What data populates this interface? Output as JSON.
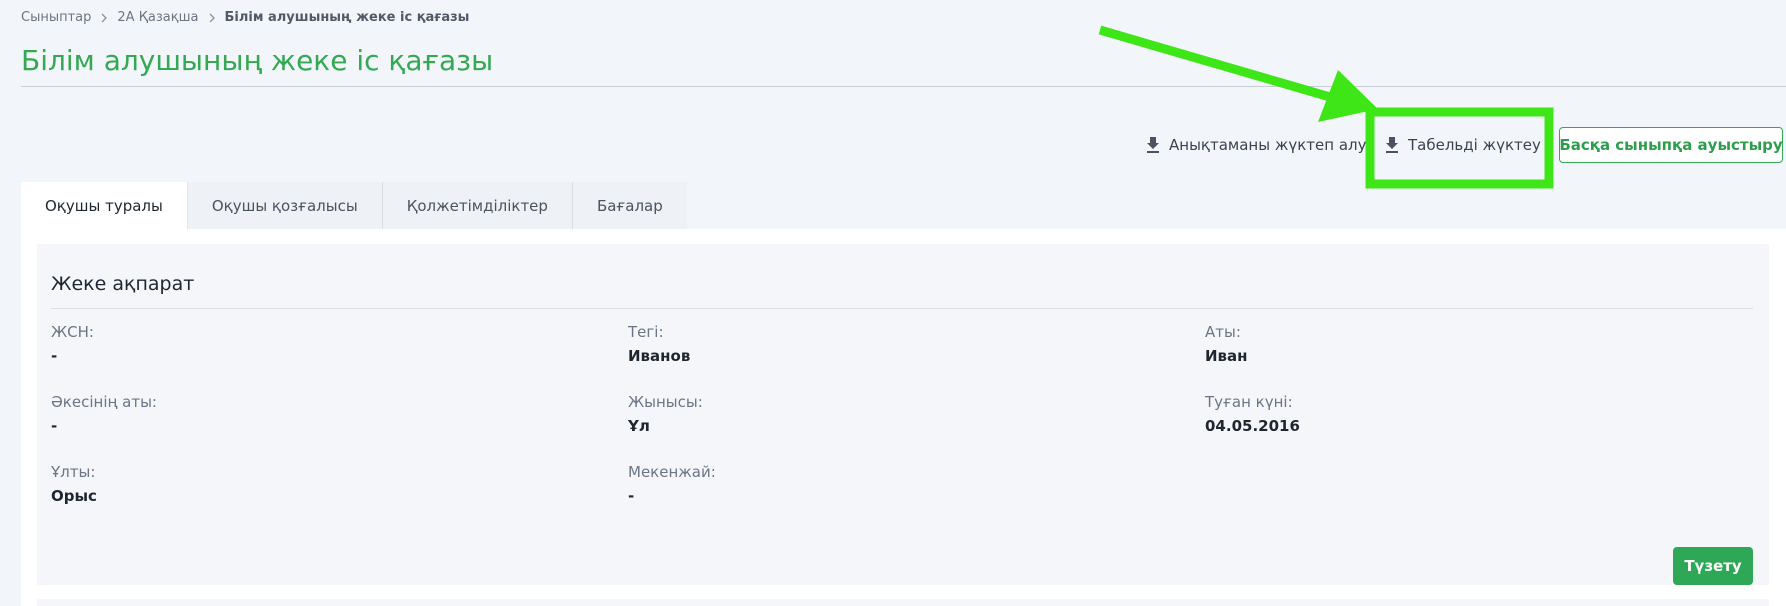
{
  "breadcrumb": {
    "items": [
      "Сыныптар",
      "2А Қазақша",
      "Білім алушының жеке іс қағазы"
    ]
  },
  "page": {
    "title": "Білім алушының жеке іс қағазы"
  },
  "actions": {
    "download_certificate": "Анықтаманы жүктеп алу",
    "download_tabel": "Табельді жүктеу",
    "transfer_class": "Басқа сыныпқа ауыстыру"
  },
  "tabs": [
    {
      "label": "Оқушы туралы",
      "active": true
    },
    {
      "label": "Оқушы қозғалысы",
      "active": false
    },
    {
      "label": "Қолжетімділіктер",
      "active": false
    },
    {
      "label": "Бағалар",
      "active": false
    }
  ],
  "personal": {
    "title": "Жеке ақпарат",
    "fields": [
      {
        "label": "ЖСН:",
        "value": "-"
      },
      {
        "label": "Тегі:",
        "value": "Иванов"
      },
      {
        "label": "Аты:",
        "value": "Иван"
      },
      {
        "label": "Әкесінің аты:",
        "value": "-"
      },
      {
        "label": "Жынысы:",
        "value": "Ұл"
      },
      {
        "label": "Туған күні:",
        "value": "04.05.2016"
      },
      {
        "label": "Ұлты:",
        "value": "Орыс"
      },
      {
        "label": "Мекенжай:",
        "value": "-"
      }
    ],
    "edit_label": "Түзету"
  },
  "colors": {
    "accent_green": "#34a853",
    "annotation_green": "#3ee617",
    "background": "#f2f6fa"
  },
  "icons": {
    "breadcrumb_separator": "chevron-right-icon",
    "download": "download-icon"
  }
}
